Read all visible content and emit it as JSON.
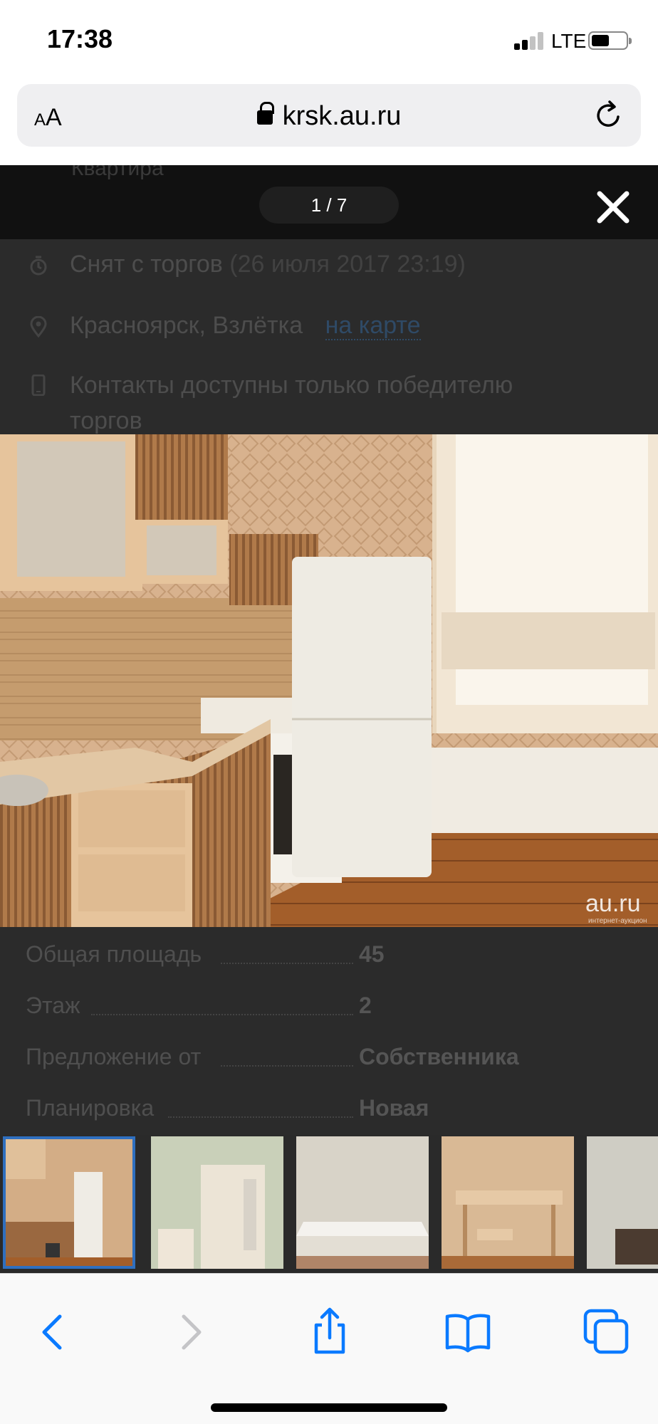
{
  "status_bar": {
    "time": "17:38",
    "network": "LTE",
    "signal_bars": 2,
    "signal_bars_total": 4
  },
  "browser": {
    "text_size_label_small": "A",
    "text_size_label_large": "A",
    "url": "krsk.au.ru"
  },
  "viewer": {
    "counter": "1 / 7",
    "current_index": 1,
    "total": 7
  },
  "page": {
    "header_ghost": "Квартира",
    "status": "Снят с торгов",
    "status_date": "(26 июля 2017 23:19)",
    "location": "Красноярск, Взлётка",
    "map_link": "на карте",
    "contacts_line1": "Контакты доступны только победителю",
    "contacts_line2": "торгов"
  },
  "photo": {
    "watermark": "au.ru",
    "watermark_sub": "интернет-аукцион"
  },
  "specs": [
    {
      "key": "Общая площадь",
      "value": "45"
    },
    {
      "key": "Этаж",
      "value": "2"
    },
    {
      "key": "Предложение от",
      "value": "Собственника"
    },
    {
      "key": "Планировка",
      "value": "Новая"
    }
  ],
  "thumbnails": [
    {
      "name": "kitchen",
      "active": true
    },
    {
      "name": "wardrobe",
      "active": false
    },
    {
      "name": "bed",
      "active": false
    },
    {
      "name": "table",
      "active": false
    },
    {
      "name": "sofa",
      "active": false
    }
  ],
  "toolbar": {
    "icons": [
      "back-icon",
      "forward-icon",
      "share-icon",
      "bookmarks-icon",
      "tabs-icon"
    ]
  },
  "colors": {
    "accent": "#0a7aff",
    "overlay": "#111111",
    "active_thumb_border": "#2f6fbf"
  }
}
